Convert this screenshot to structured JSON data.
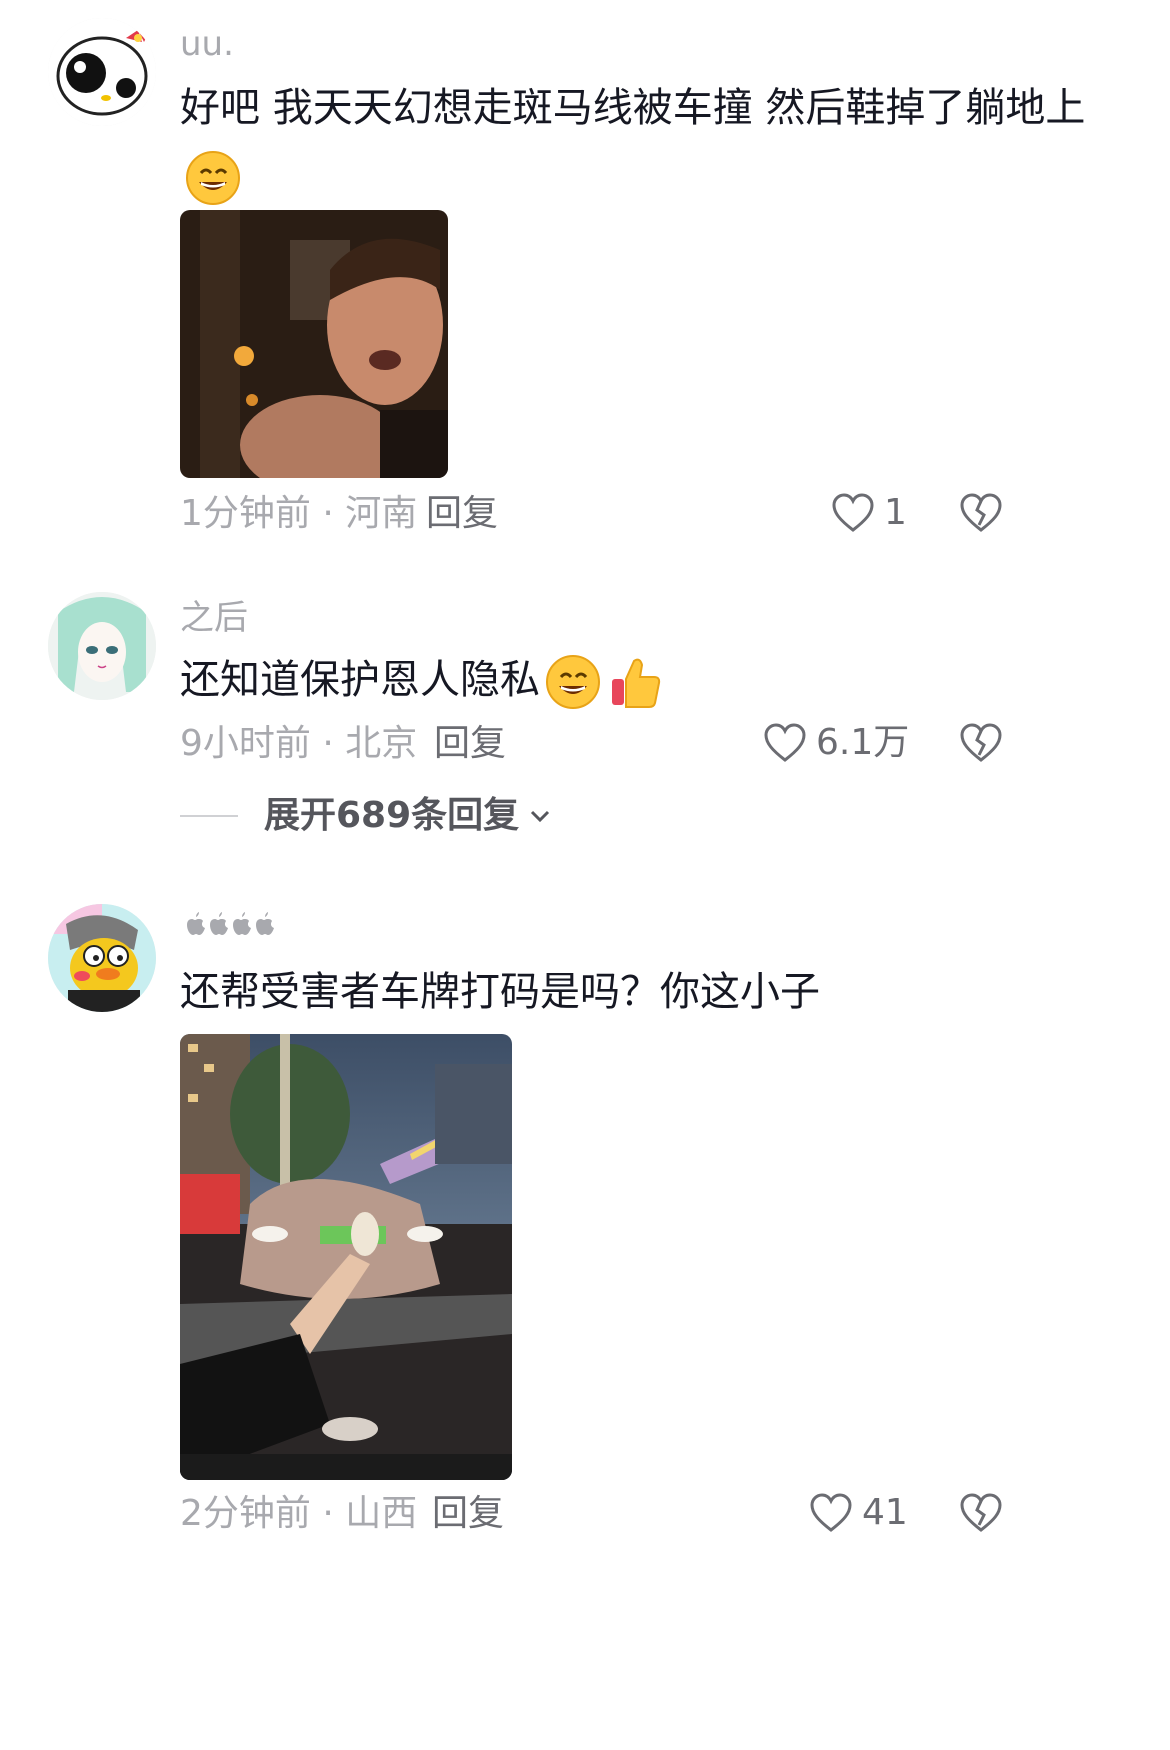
{
  "comments": [
    {
      "username": "uu.",
      "text": "好吧 我天天幻想走斑马线被车撞 然后鞋掉了躺地上",
      "emoji": "grinning-sweat-emoji",
      "media": "gif-man-surprised",
      "time": "1分钟前",
      "location": "河南",
      "reply_label": "回复",
      "likes": "1"
    },
    {
      "username": "之后",
      "text": "还知道保护恩人隐私",
      "emoji": "grinning-sweat-emoji",
      "emoji2": "thumbs-up-emoji",
      "time": "9小时前",
      "location": "北京",
      "reply_label": "回复",
      "likes": "6.1万",
      "expand_label": "展开689条回复"
    },
    {
      "username": "",
      "text": "还帮受害者车牌打码是吗？你这小子",
      "media": "photo-car-night-street",
      "time": "2分钟前",
      "location": "山西",
      "reply_label": "回复",
      "likes": "41"
    }
  ],
  "separator": " · ",
  "colors": {
    "meta_gray": "#a8a9ae",
    "text_dark": "#161823",
    "action_gray": "#6b6c72"
  }
}
